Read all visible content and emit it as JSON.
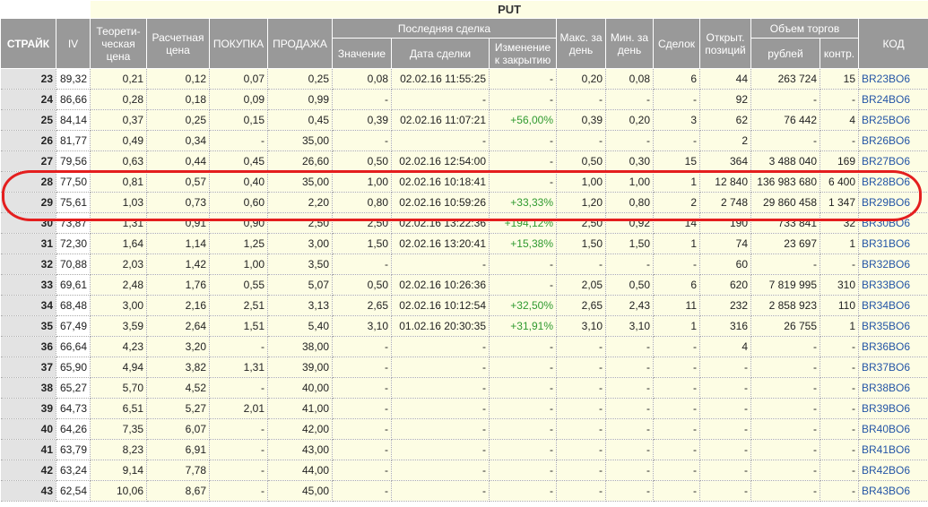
{
  "header": {
    "put_title": "PUT",
    "strike": "СТРАЙК",
    "iv": "IV",
    "theoretical": "Теорети-ческая цена",
    "settlement": "Расчетная цена",
    "bid": "ПОКУПКА",
    "ask": "ПРОДАЖА",
    "last_trade": "Последняя сделка",
    "last_value": "Значение",
    "last_date": "Дата сделки",
    "last_change": "Изменение к закрытию",
    "max_day": "Макс. за день",
    "min_day": "Мин. за день",
    "deals": "Сделок",
    "open_interest": "Открыт. позиций",
    "volume": "Объем торгов",
    "volume_rub": "рублей",
    "volume_contracts": "контр.",
    "code": "КОД"
  },
  "rows": [
    {
      "strike": "23",
      "iv": "89,32",
      "theo": "0,21",
      "settle": "0,12",
      "bid": "0,07",
      "ask": "0,25",
      "last": "0,08",
      "date": "02.02.16 11:55:25",
      "change": "-",
      "max": "0,20",
      "min": "0,08",
      "deals": "6",
      "oi": "44",
      "rub": "263 724",
      "contr": "15",
      "code": "BR23BO6"
    },
    {
      "strike": "24",
      "iv": "86,66",
      "theo": "0,28",
      "settle": "0,18",
      "bid": "0,09",
      "ask": "0,99",
      "last": "-",
      "date": "-",
      "change": "-",
      "max": "-",
      "min": "-",
      "deals": "-",
      "oi": "92",
      "rub": "-",
      "contr": "-",
      "code": "BR24BO6"
    },
    {
      "strike": "25",
      "iv": "84,14",
      "theo": "0,37",
      "settle": "0,25",
      "bid": "0,15",
      "ask": "0,45",
      "last": "0,39",
      "date": "02.02.16 11:07:21",
      "change": "+56,00%",
      "max": "0,39",
      "min": "0,20",
      "deals": "3",
      "oi": "62",
      "rub": "76 442",
      "contr": "4",
      "code": "BR25BO6"
    },
    {
      "strike": "26",
      "iv": "81,77",
      "theo": "0,49",
      "settle": "0,34",
      "bid": "-",
      "ask": "35,00",
      "last": "-",
      "date": "-",
      "change": "-",
      "max": "-",
      "min": "-",
      "deals": "-",
      "oi": "2",
      "rub": "-",
      "contr": "-",
      "code": "BR26BO6"
    },
    {
      "strike": "27",
      "iv": "79,56",
      "theo": "0,63",
      "settle": "0,44",
      "bid": "0,45",
      "ask": "26,60",
      "last": "0,50",
      "date": "02.02.16 12:54:00",
      "change": "-",
      "max": "0,50",
      "min": "0,30",
      "deals": "15",
      "oi": "364",
      "rub": "3 488 040",
      "contr": "169",
      "code": "BR27BO6"
    },
    {
      "strike": "28",
      "iv": "77,50",
      "theo": "0,81",
      "settle": "0,57",
      "bid": "0,40",
      "ask": "35,00",
      "last": "1,00",
      "date": "02.02.16 10:18:41",
      "change": "-",
      "max": "1,00",
      "min": "1,00",
      "deals": "1",
      "oi": "12 840",
      "rub": "136 983 680",
      "contr": "6 400",
      "code": "BR28BO6"
    },
    {
      "strike": "29",
      "iv": "75,61",
      "theo": "1,03",
      "settle": "0,73",
      "bid": "0,60",
      "ask": "2,20",
      "last": "0,80",
      "date": "02.02.16 10:59:26",
      "change": "+33,33%",
      "max": "1,20",
      "min": "0,80",
      "deals": "2",
      "oi": "2 748",
      "rub": "29 860 458",
      "contr": "1 347",
      "code": "BR29BO6"
    },
    {
      "strike": "30",
      "iv": "73,87",
      "theo": "1,31",
      "settle": "0,91",
      "bid": "0,90",
      "ask": "2,50",
      "last": "2,50",
      "date": "02.02.16 13:22:36",
      "change": "+194,12%",
      "max": "2,50",
      "min": "0,92",
      "deals": "14",
      "oi": "190",
      "rub": "733 841",
      "contr": "32",
      "code": "BR30BO6"
    },
    {
      "strike": "31",
      "iv": "72,30",
      "theo": "1,64",
      "settle": "1,14",
      "bid": "1,25",
      "ask": "3,00",
      "last": "1,50",
      "date": "02.02.16 13:20:41",
      "change": "+15,38%",
      "max": "1,50",
      "min": "1,50",
      "deals": "1",
      "oi": "74",
      "rub": "23 697",
      "contr": "1",
      "code": "BR31BO6"
    },
    {
      "strike": "32",
      "iv": "70,88",
      "theo": "2,03",
      "settle": "1,42",
      "bid": "1,00",
      "ask": "3,50",
      "last": "-",
      "date": "-",
      "change": "-",
      "max": "-",
      "min": "-",
      "deals": "-",
      "oi": "60",
      "rub": "-",
      "contr": "-",
      "code": "BR32BO6"
    },
    {
      "strike": "33",
      "iv": "69,61",
      "theo": "2,48",
      "settle": "1,76",
      "bid": "0,55",
      "ask": "5,07",
      "last": "0,50",
      "date": "02.02.16 10:26:36",
      "change": "-",
      "max": "2,05",
      "min": "0,50",
      "deals": "6",
      "oi": "620",
      "rub": "7 819 995",
      "contr": "310",
      "code": "BR33BO6"
    },
    {
      "strike": "34",
      "iv": "68,48",
      "theo": "3,00",
      "settle": "2,16",
      "bid": "2,51",
      "ask": "3,13",
      "last": "2,65",
      "date": "02.02.16 10:12:54",
      "change": "+32,50%",
      "max": "2,65",
      "min": "2,43",
      "deals": "11",
      "oi": "232",
      "rub": "2 858 923",
      "contr": "110",
      "code": "BR34BO6"
    },
    {
      "strike": "35",
      "iv": "67,49",
      "theo": "3,59",
      "settle": "2,64",
      "bid": "1,51",
      "ask": "5,40",
      "last": "3,10",
      "date": "01.02.16 20:30:35",
      "change": "+31,91%",
      "max": "3,10",
      "min": "3,10",
      "deals": "1",
      "oi": "316",
      "rub": "26 755",
      "contr": "1",
      "code": "BR35BO6"
    },
    {
      "strike": "36",
      "iv": "66,64",
      "theo": "4,23",
      "settle": "3,20",
      "bid": "-",
      "ask": "38,00",
      "last": "-",
      "date": "-",
      "change": "-",
      "max": "-",
      "min": "-",
      "deals": "-",
      "oi": "4",
      "rub": "-",
      "contr": "-",
      "code": "BR36BO6"
    },
    {
      "strike": "37",
      "iv": "65,90",
      "theo": "4,94",
      "settle": "3,82",
      "bid": "1,31",
      "ask": "39,00",
      "last": "-",
      "date": "-",
      "change": "-",
      "max": "-",
      "min": "-",
      "deals": "-",
      "oi": "-",
      "rub": "-",
      "contr": "-",
      "code": "BR37BO6"
    },
    {
      "strike": "38",
      "iv": "65,27",
      "theo": "5,70",
      "settle": "4,52",
      "bid": "-",
      "ask": "40,00",
      "last": "-",
      "date": "-",
      "change": "-",
      "max": "-",
      "min": "-",
      "deals": "-",
      "oi": "-",
      "rub": "-",
      "contr": "-",
      "code": "BR38BO6"
    },
    {
      "strike": "39",
      "iv": "64,73",
      "theo": "6,51",
      "settle": "5,27",
      "bid": "2,01",
      "ask": "41,00",
      "last": "-",
      "date": "-",
      "change": "-",
      "max": "-",
      "min": "-",
      "deals": "-",
      "oi": "-",
      "rub": "-",
      "contr": "-",
      "code": "BR39BO6"
    },
    {
      "strike": "40",
      "iv": "64,26",
      "theo": "7,35",
      "settle": "6,07",
      "bid": "-",
      "ask": "42,00",
      "last": "-",
      "date": "-",
      "change": "-",
      "max": "-",
      "min": "-",
      "deals": "-",
      "oi": "-",
      "rub": "-",
      "contr": "-",
      "code": "BR40BO6"
    },
    {
      "strike": "41",
      "iv": "63,79",
      "theo": "8,23",
      "settle": "6,91",
      "bid": "-",
      "ask": "43,00",
      "last": "-",
      "date": "-",
      "change": "-",
      "max": "-",
      "min": "-",
      "deals": "-",
      "oi": "-",
      "rub": "-",
      "contr": "-",
      "code": "BR41BO6"
    },
    {
      "strike": "42",
      "iv": "63,24",
      "theo": "9,14",
      "settle": "7,78",
      "bid": "-",
      "ask": "44,00",
      "last": "-",
      "date": "-",
      "change": "-",
      "max": "-",
      "min": "-",
      "deals": "-",
      "oi": "-",
      "rub": "-",
      "contr": "-",
      "code": "BR42BO6"
    },
    {
      "strike": "43",
      "iv": "62,54",
      "theo": "10,06",
      "settle": "8,67",
      "bid": "-",
      "ask": "45,00",
      "last": "-",
      "date": "-",
      "change": "-",
      "max": "-",
      "min": "-",
      "deals": "-",
      "oi": "-",
      "rub": "-",
      "contr": "-",
      "code": "BR43BO6"
    }
  ],
  "colors": {
    "header_bg": "#999999",
    "row_bg": "#fdfde4",
    "strike_bg": "#e3e3e3",
    "positive_change": "#2f9a2f",
    "link": "#2455a6",
    "highlight": "#e41e1e"
  }
}
